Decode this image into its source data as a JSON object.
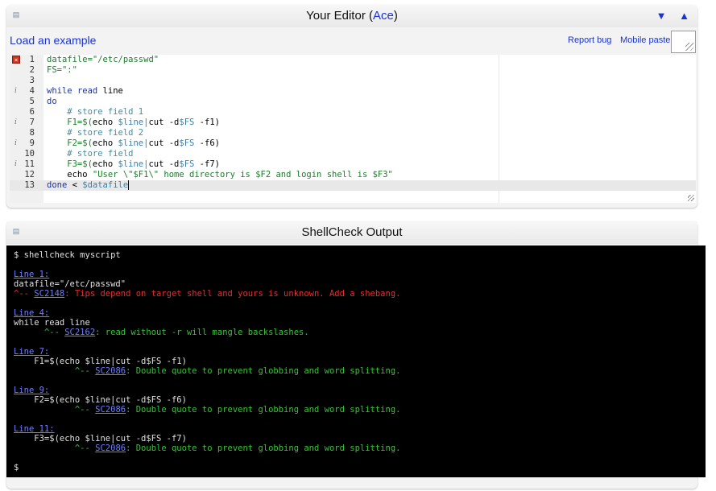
{
  "editor": {
    "title_prefix": "Your Editor (",
    "title_link": "Ace",
    "title_suffix": ")",
    "arrows": "▼ ▲",
    "load_example": "Load an example",
    "report_bug": "Report bug",
    "mobile_paste": "Mobile paste:",
    "lines": [
      {
        "n": "1",
        "mark": "err",
        "code": [
          {
            "t": "datafile=",
            "c": "str"
          },
          {
            "t": "\"/etc/passwd\"",
            "c": "str"
          }
        ]
      },
      {
        "n": "2",
        "mark": "",
        "code": [
          {
            "t": "FS=\":\"",
            "c": "str"
          }
        ]
      },
      {
        "n": "3",
        "mark": "",
        "code": []
      },
      {
        "n": "4",
        "mark": "info",
        "code": [
          {
            "t": "while",
            "c": "kw"
          },
          {
            "t": " ",
            "c": "txt"
          },
          {
            "t": "read",
            "c": "kw"
          },
          {
            "t": " line",
            "c": "txt"
          }
        ]
      },
      {
        "n": "5",
        "mark": "",
        "code": [
          {
            "t": "do",
            "c": "kw"
          }
        ]
      },
      {
        "n": "6",
        "mark": "",
        "code": [
          {
            "t": "    # store field 1",
            "c": "cmt"
          }
        ]
      },
      {
        "n": "7",
        "mark": "info",
        "code": [
          {
            "t": "    F1=$(",
            "c": "str"
          },
          {
            "t": "echo ",
            "c": "txt"
          },
          {
            "t": "$line",
            "c": "var"
          },
          {
            "t": "|",
            "c": "var"
          },
          {
            "t": "cut -d",
            "c": "txt"
          },
          {
            "t": "$FS",
            "c": "var"
          },
          {
            "t": " -f1)",
            "c": "txt"
          }
        ]
      },
      {
        "n": "8",
        "mark": "",
        "code": [
          {
            "t": "    # store field 2",
            "c": "cmt"
          }
        ]
      },
      {
        "n": "9",
        "mark": "info",
        "code": [
          {
            "t": "    F2=$(",
            "c": "str"
          },
          {
            "t": "echo ",
            "c": "txt"
          },
          {
            "t": "$line",
            "c": "var"
          },
          {
            "t": "|",
            "c": "var"
          },
          {
            "t": "cut -d",
            "c": "txt"
          },
          {
            "t": "$FS",
            "c": "var"
          },
          {
            "t": " -f6)",
            "c": "txt"
          }
        ]
      },
      {
        "n": "10",
        "mark": "",
        "code": [
          {
            "t": "    # store field",
            "c": "cmt"
          }
        ]
      },
      {
        "n": "11",
        "mark": "info",
        "code": [
          {
            "t": "    F3=$(",
            "c": "str"
          },
          {
            "t": "echo ",
            "c": "txt"
          },
          {
            "t": "$line",
            "c": "var"
          },
          {
            "t": "|",
            "c": "var"
          },
          {
            "t": "cut -d",
            "c": "txt"
          },
          {
            "t": "$FS",
            "c": "var"
          },
          {
            "t": " -f7)",
            "c": "txt"
          }
        ]
      },
      {
        "n": "12",
        "mark": "",
        "code": [
          {
            "t": "    echo ",
            "c": "txt"
          },
          {
            "t": "\"User \\\"$F1\\\" home directory is $F2 and login shell is $F3\"",
            "c": "str"
          }
        ]
      },
      {
        "n": "13",
        "mark": "",
        "active": true,
        "code": [
          {
            "t": "done",
            "c": "kw"
          },
          {
            "t": " < ",
            "c": "txt"
          },
          {
            "t": "$datafile",
            "c": "var"
          }
        ]
      }
    ]
  },
  "output": {
    "title": "ShellCheck Output",
    "lines": [
      {
        "row": 0,
        "parts": [
          {
            "t": "$ shellcheck myscript",
            "c": ""
          }
        ]
      },
      {
        "row": 2,
        "parts": [
          {
            "t": "Line 1:",
            "c": "link"
          }
        ]
      },
      {
        "row": 3,
        "parts": [
          {
            "t": "datafile=\"/etc/passwd\"",
            "c": ""
          }
        ]
      },
      {
        "row": 4,
        "parts": [
          {
            "t": "^-- ",
            "c": "red"
          },
          {
            "t": "SC2148",
            "c": "code"
          },
          {
            "t": ": Tips depend on target shell and yours is unknown. Add a shebang.",
            "c": "red"
          }
        ]
      },
      {
        "row": 6,
        "parts": [
          {
            "t": "Line 4:",
            "c": "link"
          }
        ]
      },
      {
        "row": 7,
        "parts": [
          {
            "t": "while read line",
            "c": ""
          }
        ]
      },
      {
        "row": 8,
        "parts": [
          {
            "t": "      ^-- ",
            "c": "green"
          },
          {
            "t": "SC2162",
            "c": "code"
          },
          {
            "t": ": read without -r will mangle backslashes.",
            "c": "green"
          }
        ]
      },
      {
        "row": 10,
        "parts": [
          {
            "t": "Line 7:",
            "c": "link"
          }
        ]
      },
      {
        "row": 11,
        "parts": [
          {
            "t": "    F1=$(echo $line|cut -d$FS -f1)",
            "c": ""
          }
        ]
      },
      {
        "row": 12,
        "parts": [
          {
            "t": "            ^-- ",
            "c": "green"
          },
          {
            "t": "SC2086",
            "c": "code"
          },
          {
            "t": ": Double quote to prevent globbing and word splitting.",
            "c": "green"
          }
        ]
      },
      {
        "row": 14,
        "parts": [
          {
            "t": "Line 9:",
            "c": "link"
          }
        ]
      },
      {
        "row": 15,
        "parts": [
          {
            "t": "    F2=$(echo $line|cut -d$FS -f6)",
            "c": ""
          }
        ]
      },
      {
        "row": 16,
        "parts": [
          {
            "t": "            ^-- ",
            "c": "green"
          },
          {
            "t": "SC2086",
            "c": "code"
          },
          {
            "t": ": Double quote to prevent globbing and word splitting.",
            "c": "green"
          }
        ]
      },
      {
        "row": 18,
        "parts": [
          {
            "t": "Line 11:",
            "c": "link"
          }
        ]
      },
      {
        "row": 19,
        "parts": [
          {
            "t": "    F3=$(echo $line|cut -d$FS -f7)",
            "c": ""
          }
        ]
      },
      {
        "row": 20,
        "parts": [
          {
            "t": "            ^-- ",
            "c": "green"
          },
          {
            "t": "SC2086",
            "c": "code"
          },
          {
            "t": ": Double quote to prevent globbing and word splitting.",
            "c": "green"
          }
        ]
      },
      {
        "row": 22,
        "parts": [
          {
            "t": "$",
            "c": ""
          }
        ]
      }
    ]
  }
}
